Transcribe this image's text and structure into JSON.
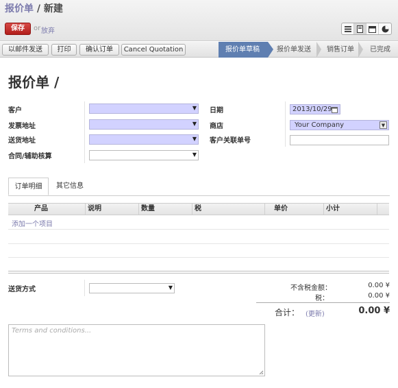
{
  "header": {
    "breadcrumb_parent": "报价单",
    "breadcrumb_sep": " / ",
    "breadcrumb_current": "新建",
    "save_label": "保存",
    "or_text": "or",
    "discard_label": "放弃"
  },
  "view_switcher": [
    "list-icon",
    "form-icon",
    "calendar-icon",
    "graph-icon"
  ],
  "actions": {
    "email": "以邮件发送",
    "print": "打印",
    "confirm": "确认订单",
    "cancel": "Cancel Quotation"
  },
  "stages": [
    "报价单草稿",
    "报价单发送",
    "销售订单",
    "已完成"
  ],
  "active_stage": "报价单草稿",
  "form": {
    "title": "报价单 /",
    "labels": {
      "customer": "客户",
      "invoice_addr": "发票地址",
      "delivery_addr": "送货地址",
      "contract": "合同/辅助核算",
      "date": "日期",
      "shop": "商店",
      "client_ref": "客户关联单号"
    },
    "values": {
      "date": "2013/10/29",
      "shop": "Your Company"
    }
  },
  "tabs": [
    "订单明细",
    "其它信息"
  ],
  "active_tab": "订单明细",
  "table": {
    "columns": [
      "产品",
      "说明",
      "数量",
      "税",
      "单价",
      "小计"
    ],
    "add_item": "添加一个项目"
  },
  "footer": {
    "shipping_label": "送货方式",
    "untaxed_label": "不含税金额：",
    "untaxed_value": "0.00 ¥",
    "tax_label": "税：",
    "tax_value": "0.00 ¥",
    "total_label": "合计：",
    "update_link": "(更新)",
    "total_value": "0.00 ¥",
    "terms_placeholder": "Terms and conditions..."
  },
  "colors": {
    "accent": "#7c7bad",
    "save": "#c0302c",
    "stage_active": "#5f7fb1",
    "required": "#d2d2ff"
  }
}
